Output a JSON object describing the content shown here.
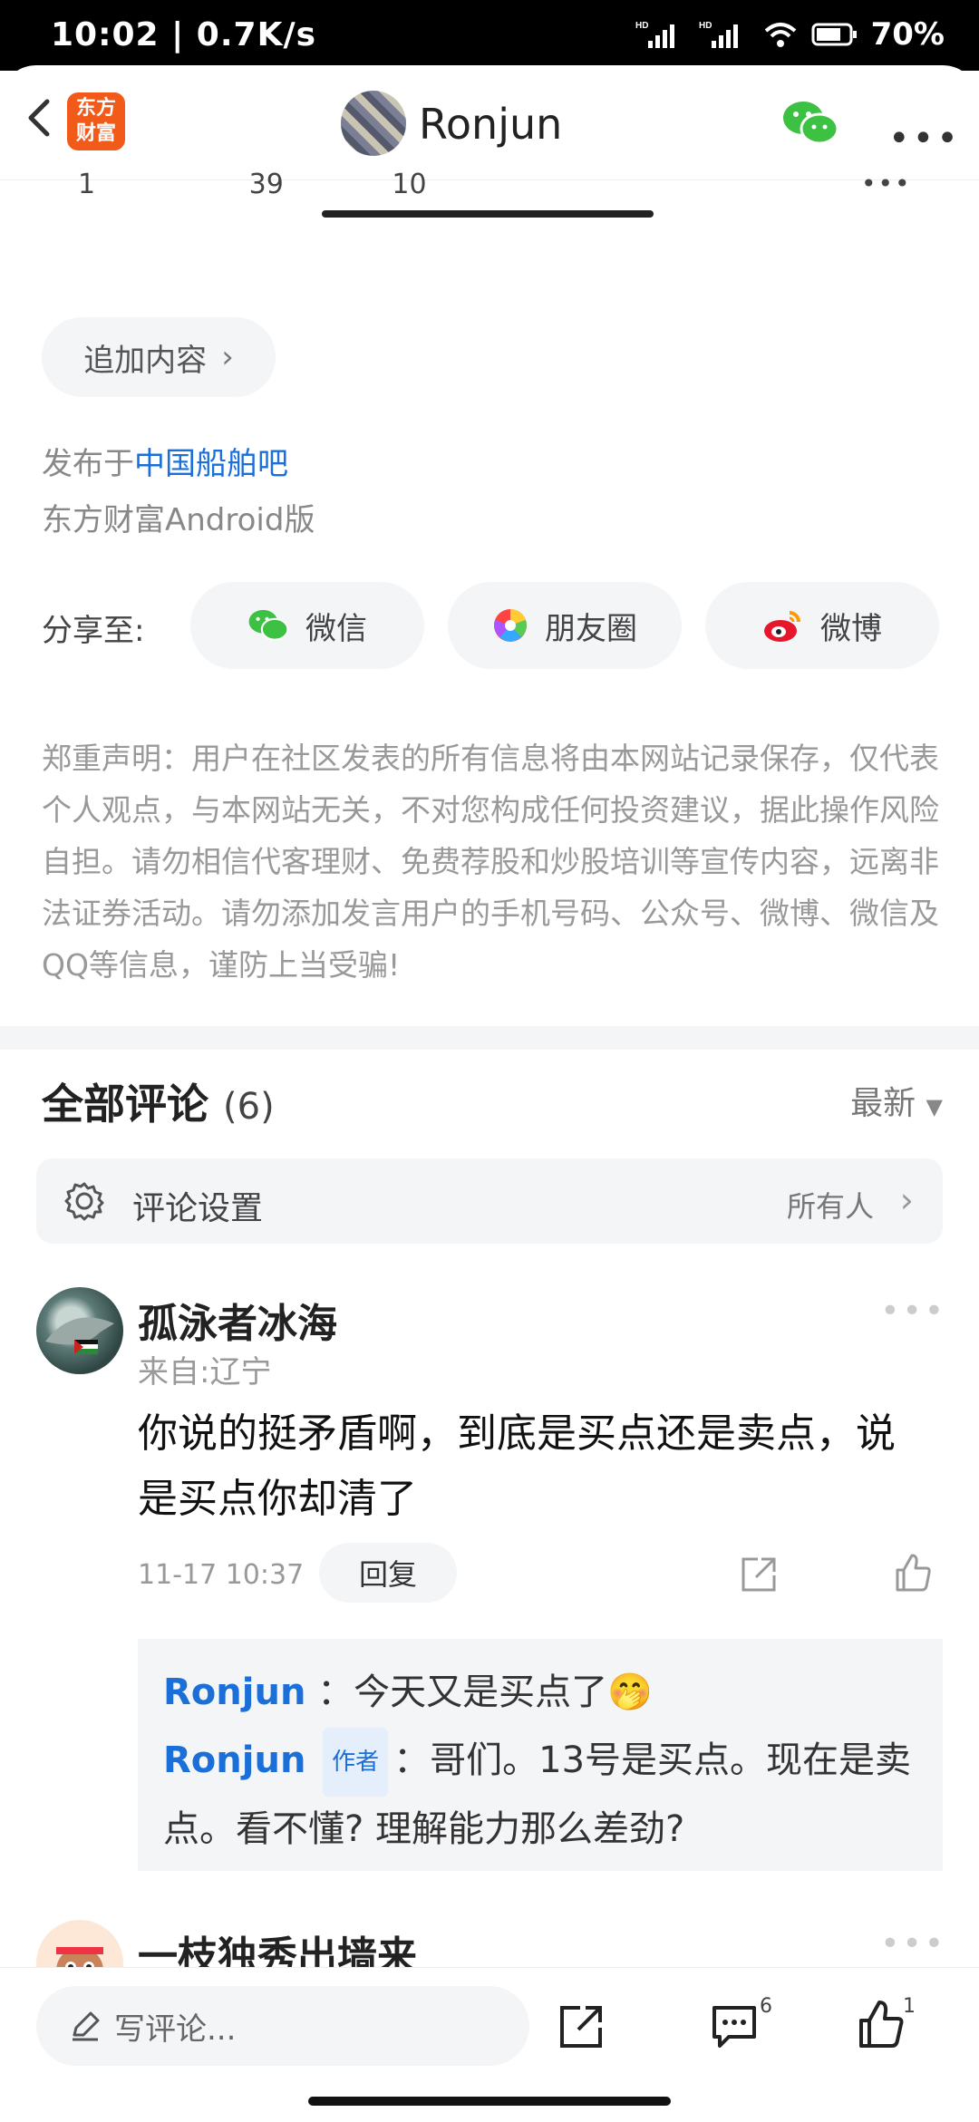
{
  "status": {
    "time": "10:02 | 0.7K/s",
    "battery": "70%"
  },
  "header": {
    "logo_text": "东方财富",
    "title": "Ronjun"
  },
  "partial_stats": {
    "a": "1",
    "b": "39",
    "c": "10"
  },
  "append_chip": {
    "label": "追加内容"
  },
  "published": {
    "prefix": "发布于",
    "forum": "中国船舶吧",
    "client": "东方财富Android版"
  },
  "share": {
    "label": "分享至:",
    "targets": [
      {
        "label": "微信"
      },
      {
        "label": "朋友圈"
      },
      {
        "label": "微博"
      }
    ]
  },
  "disclaimer": "郑重声明：用户在社区发表的所有信息将由本网站记录保存，仅代表个人观点，与本网站无关，不对您构成任何投资建议，据此操作风险自担。请勿相信代客理财、免费荐股和炒股培训等宣传内容，远离非法证券活动。请勿添加发言用户的手机号码、公众号、微博、微信及QQ等信息，谨防上当受骗!",
  "comments": {
    "title": "全部评论",
    "count": "(6)",
    "sort": "最新",
    "settings": {
      "label": "评论设置",
      "value": "所有人"
    },
    "items": [
      {
        "name": "孤泳者冰海",
        "location": "来自:辽宁",
        "text": "你说的挺矛盾啊，到底是买点还是卖点，说是买点你却清了",
        "time": "11-17 10:37",
        "reply_label": "回复",
        "replies": [
          {
            "name": "Ronjun",
            "text": "：今天又是买点了",
            "emoji": "🤭"
          },
          {
            "name": "Ronjun",
            "tag": "作者",
            "text": "：哥们。13号是买点。现在是卖点。看不懂? 理解能力那么差劲?"
          }
        ]
      },
      {
        "name": "一枝独秀出墙来"
      }
    ]
  },
  "bottom": {
    "placeholder": "写评论...",
    "comment_badge": "6",
    "like_badge": "1"
  }
}
